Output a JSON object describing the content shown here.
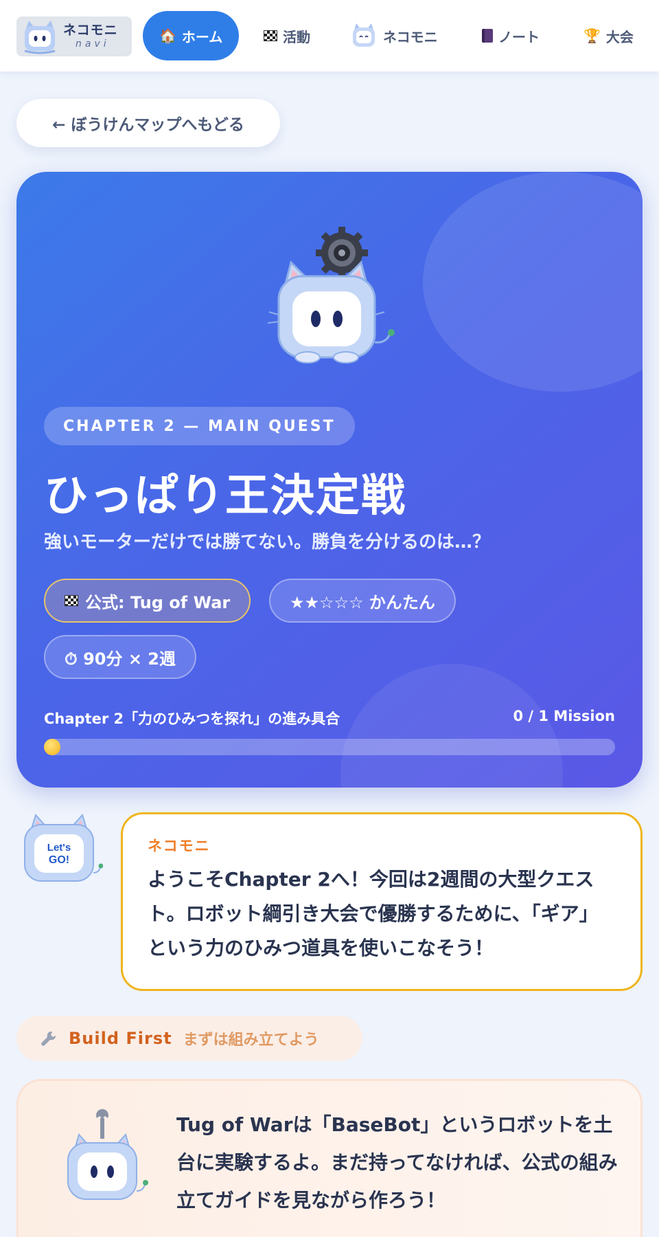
{
  "nav": {
    "logo_title": "ネコモニ",
    "logo_sub": "navi",
    "items": [
      {
        "icon": "house-icon",
        "label": "ホーム",
        "active": true
      },
      {
        "icon": "checkered-flag-icon",
        "label": "活動"
      },
      {
        "icon": "cat-icon",
        "label": "ネコモニ"
      },
      {
        "icon": "notebook-icon",
        "label": "ノート"
      },
      {
        "icon": "trophy-icon",
        "label": "大会"
      }
    ]
  },
  "back_button": {
    "label": "← ぼうけんマップへもどる"
  },
  "hero": {
    "chapter_badge": "CHAPTER 2 — MAIN QUEST",
    "title": "ひっぱり王決定戦",
    "subtitle": "強いモーターだけでは勝てない。勝負を分けるのは…？",
    "pills": {
      "official": "公式: Tug of War",
      "difficulty": "★★☆☆☆ かんたん",
      "duration": "⏱ 90分 × 2週"
    },
    "progress": {
      "label": "Chapter 2「力のひみつを探れ」の進み具合",
      "count": "0 / 1 Mission",
      "completed": 0,
      "total": 1
    }
  },
  "speech": {
    "mascot_badge": "Let's GO!",
    "name": "ネコモニ",
    "text": "ようこそChapter 2へ！今回は2週間の大型クエスト。ロボット綱引き大会で優勝するために、「ギア」という力のひみつ道具を使いこなそう！"
  },
  "build_first": {
    "title": "Build First",
    "subtitle": "まずは組み立てよう",
    "text": "Tug of Warは「BaseBot」というロボットを土台に実験するよ。まだ持ってなければ、公式の組み立てガイドを見ながら作ろう！"
  },
  "colors": {
    "accent": "#2f7ee8",
    "hero_gradient_start": "#3c7ae9",
    "hero_gradient_end": "#5a58e6",
    "speech_border": "#f0b51c",
    "speaker_name": "#ef7d26",
    "build_title": "#d2621e"
  }
}
